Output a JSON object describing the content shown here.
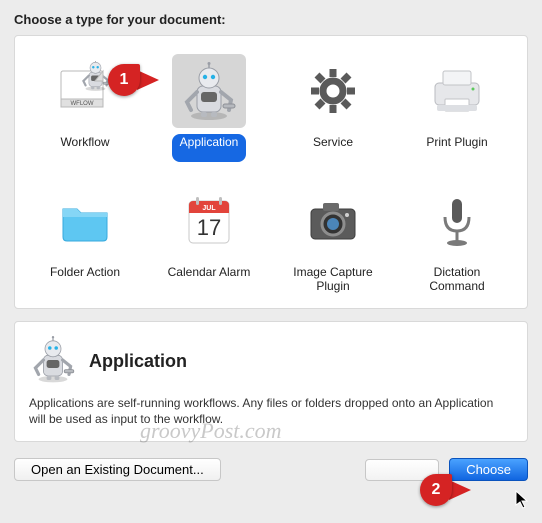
{
  "heading": "Choose a type for your document:",
  "types": [
    {
      "label": "Workflow",
      "icon": "workflow"
    },
    {
      "label": "Application",
      "icon": "application"
    },
    {
      "label": "Service",
      "icon": "service"
    },
    {
      "label": "Print Plugin",
      "icon": "print"
    },
    {
      "label": "Folder Action",
      "icon": "folder"
    },
    {
      "label": "Calendar Alarm",
      "icon": "calendar"
    },
    {
      "label": "Image Capture Plugin",
      "icon": "camera"
    },
    {
      "label": "Dictation Command",
      "icon": "mic"
    }
  ],
  "selected_index": 1,
  "calendar": {
    "month": "JUL",
    "day": "17"
  },
  "description": {
    "title": "Application",
    "body": "Applications are self-running workflows. Any files or folders dropped onto an Application will be used as input to the workflow."
  },
  "buttons": {
    "open_existing": "Open an Existing Document...",
    "choose": "Choose"
  },
  "annotations": {
    "one": "1",
    "two": "2"
  },
  "watermark": "groovyPost.com"
}
